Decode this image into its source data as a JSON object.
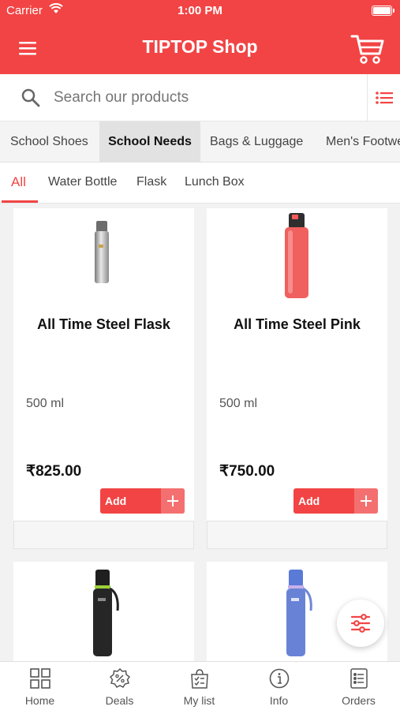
{
  "status_bar": {
    "carrier": "Carrier",
    "time": "1:00 PM"
  },
  "app_bar": {
    "title": "TIPTOP Shop",
    "menu_icon": "hamburger-menu-icon",
    "cart_icon": "shopping-cart-icon"
  },
  "search": {
    "placeholder": "Search our products",
    "search_icon": "search-icon",
    "list_icon": "list-view-icon"
  },
  "categories": [
    {
      "label": "School Shoes",
      "active": false
    },
    {
      "label": "School Needs",
      "active": true
    },
    {
      "label": "Bags & Luggage",
      "active": false
    },
    {
      "label": "Men's Footwe",
      "active": false
    }
  ],
  "subcategories": [
    {
      "label": "All",
      "active": true
    },
    {
      "label": "Water Bottle",
      "active": false
    },
    {
      "label": "Flask",
      "active": false
    },
    {
      "label": "Lunch Box",
      "active": false
    }
  ],
  "products": [
    {
      "name": "All Time Steel Flask",
      "quantity": "500 ml",
      "price": "₹825.00",
      "add_label": "Add",
      "image": "steel-flask-image"
    },
    {
      "name": "All Time Steel Pink",
      "quantity": "500 ml",
      "price": "₹750.00",
      "add_label": "Add",
      "image": "pink-bottle-image"
    },
    {
      "name": "",
      "quantity": "",
      "price": "",
      "add_label": "",
      "image": "black-bottle-image"
    },
    {
      "name": "",
      "quantity": "",
      "price": "",
      "add_label": "",
      "image": "blue-bottle-image"
    }
  ],
  "fab_icon": "filter-sliders-icon",
  "bottom_nav": [
    {
      "label": "Home",
      "icon": "home-grid-icon"
    },
    {
      "label": "Deals",
      "icon": "deals-badge-icon"
    },
    {
      "label": "My list",
      "icon": "list-bag-icon"
    },
    {
      "label": "Info",
      "icon": "info-icon"
    },
    {
      "label": "Orders",
      "icon": "orders-icon"
    }
  ],
  "colors": {
    "brand": "#f24444",
    "brand_light": "#f47070",
    "background": "#f2f2f2"
  }
}
